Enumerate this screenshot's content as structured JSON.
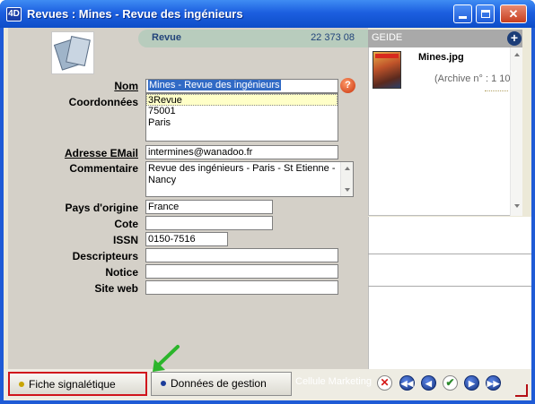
{
  "window": {
    "app_icon": "4D",
    "title": "Revues : Mines - Revue des ingénieurs",
    "minimize_icon": "minimize-icon",
    "maximize_icon": "maximize-icon",
    "close_icon": "close-icon"
  },
  "header": {
    "title": "Revue",
    "number": "22 373 08"
  },
  "form": {
    "nom_label": "Nom",
    "nom_value": "Mines - Revue des ingénieurs",
    "help_label": "?",
    "coordonnees_label": "Coordonnées",
    "coordonnees_lines": [
      "3Revue",
      "75001",
      "Paris"
    ],
    "adresse_label": "Adresse EMail",
    "adresse_value": "intermines@wanadoo.fr",
    "commentaire_label": "Commentaire",
    "commentaire_value": "Revue des ingénieurs - Paris - St Etienne - Nancy",
    "pays_label": "Pays d'origine",
    "pays_value": "France",
    "cote_label": "Cote",
    "cote_value": "",
    "issn_label": "ISSN",
    "issn_value": "0150-7516",
    "descripteurs_label": "Descripteurs",
    "descripteurs_value": "",
    "notice_label": "Notice",
    "notice_value": "",
    "site_label": "Site web",
    "site_value": ""
  },
  "geide": {
    "title": "GEIDE",
    "add_label": "+",
    "file_name": "Mines.jpg",
    "file_meta": "(Archive n° : 1 10"
  },
  "bottom": {
    "tab_fiche": "Fiche signalétique",
    "tab_donnees": "Données de gestion",
    "cellule": "Cellule Marketing",
    "nav_icons": [
      "cancel-icon",
      "first-record-icon",
      "previous-record-icon",
      "validate-icon",
      "next-record-icon",
      "last-record-icon"
    ]
  },
  "colors": {
    "titlebar": "#1c5fe0",
    "header_pill": "#b8ccbd",
    "selection": "#316ac5",
    "active_tab_border": "#d0141c",
    "highlight_arrow": "#2bb52b"
  }
}
